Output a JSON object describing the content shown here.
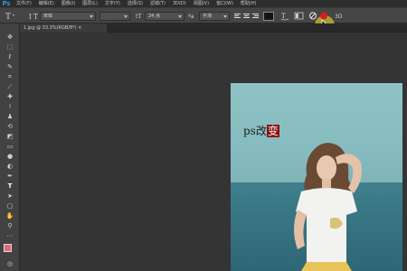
{
  "app": {
    "logo": "Ps"
  },
  "menu": [
    "文件(F)",
    "编辑(E)",
    "图像(I)",
    "图层(L)",
    "文字(Y)",
    "选择(S)",
    "滤镜(T)",
    "3D(D)",
    "视图(V)",
    "窗口(W)",
    "帮助(H)"
  ],
  "options": {
    "font_family": "宋体",
    "font_size": "24 点",
    "antialias": "平滑",
    "orientation_icon": "text-orientation-icon",
    "text_color": "#141414"
  },
  "document": {
    "tab_label": "1.jpg @ 33.3%(RGB/8*) ×"
  },
  "image": {
    "overlay_prefix": "ps改",
    "overlay_highlight": "变"
  },
  "colors": {
    "ps_blue": "#31a8ff",
    "commit_red": "#d61f1f",
    "highlight": "#8e1010"
  }
}
